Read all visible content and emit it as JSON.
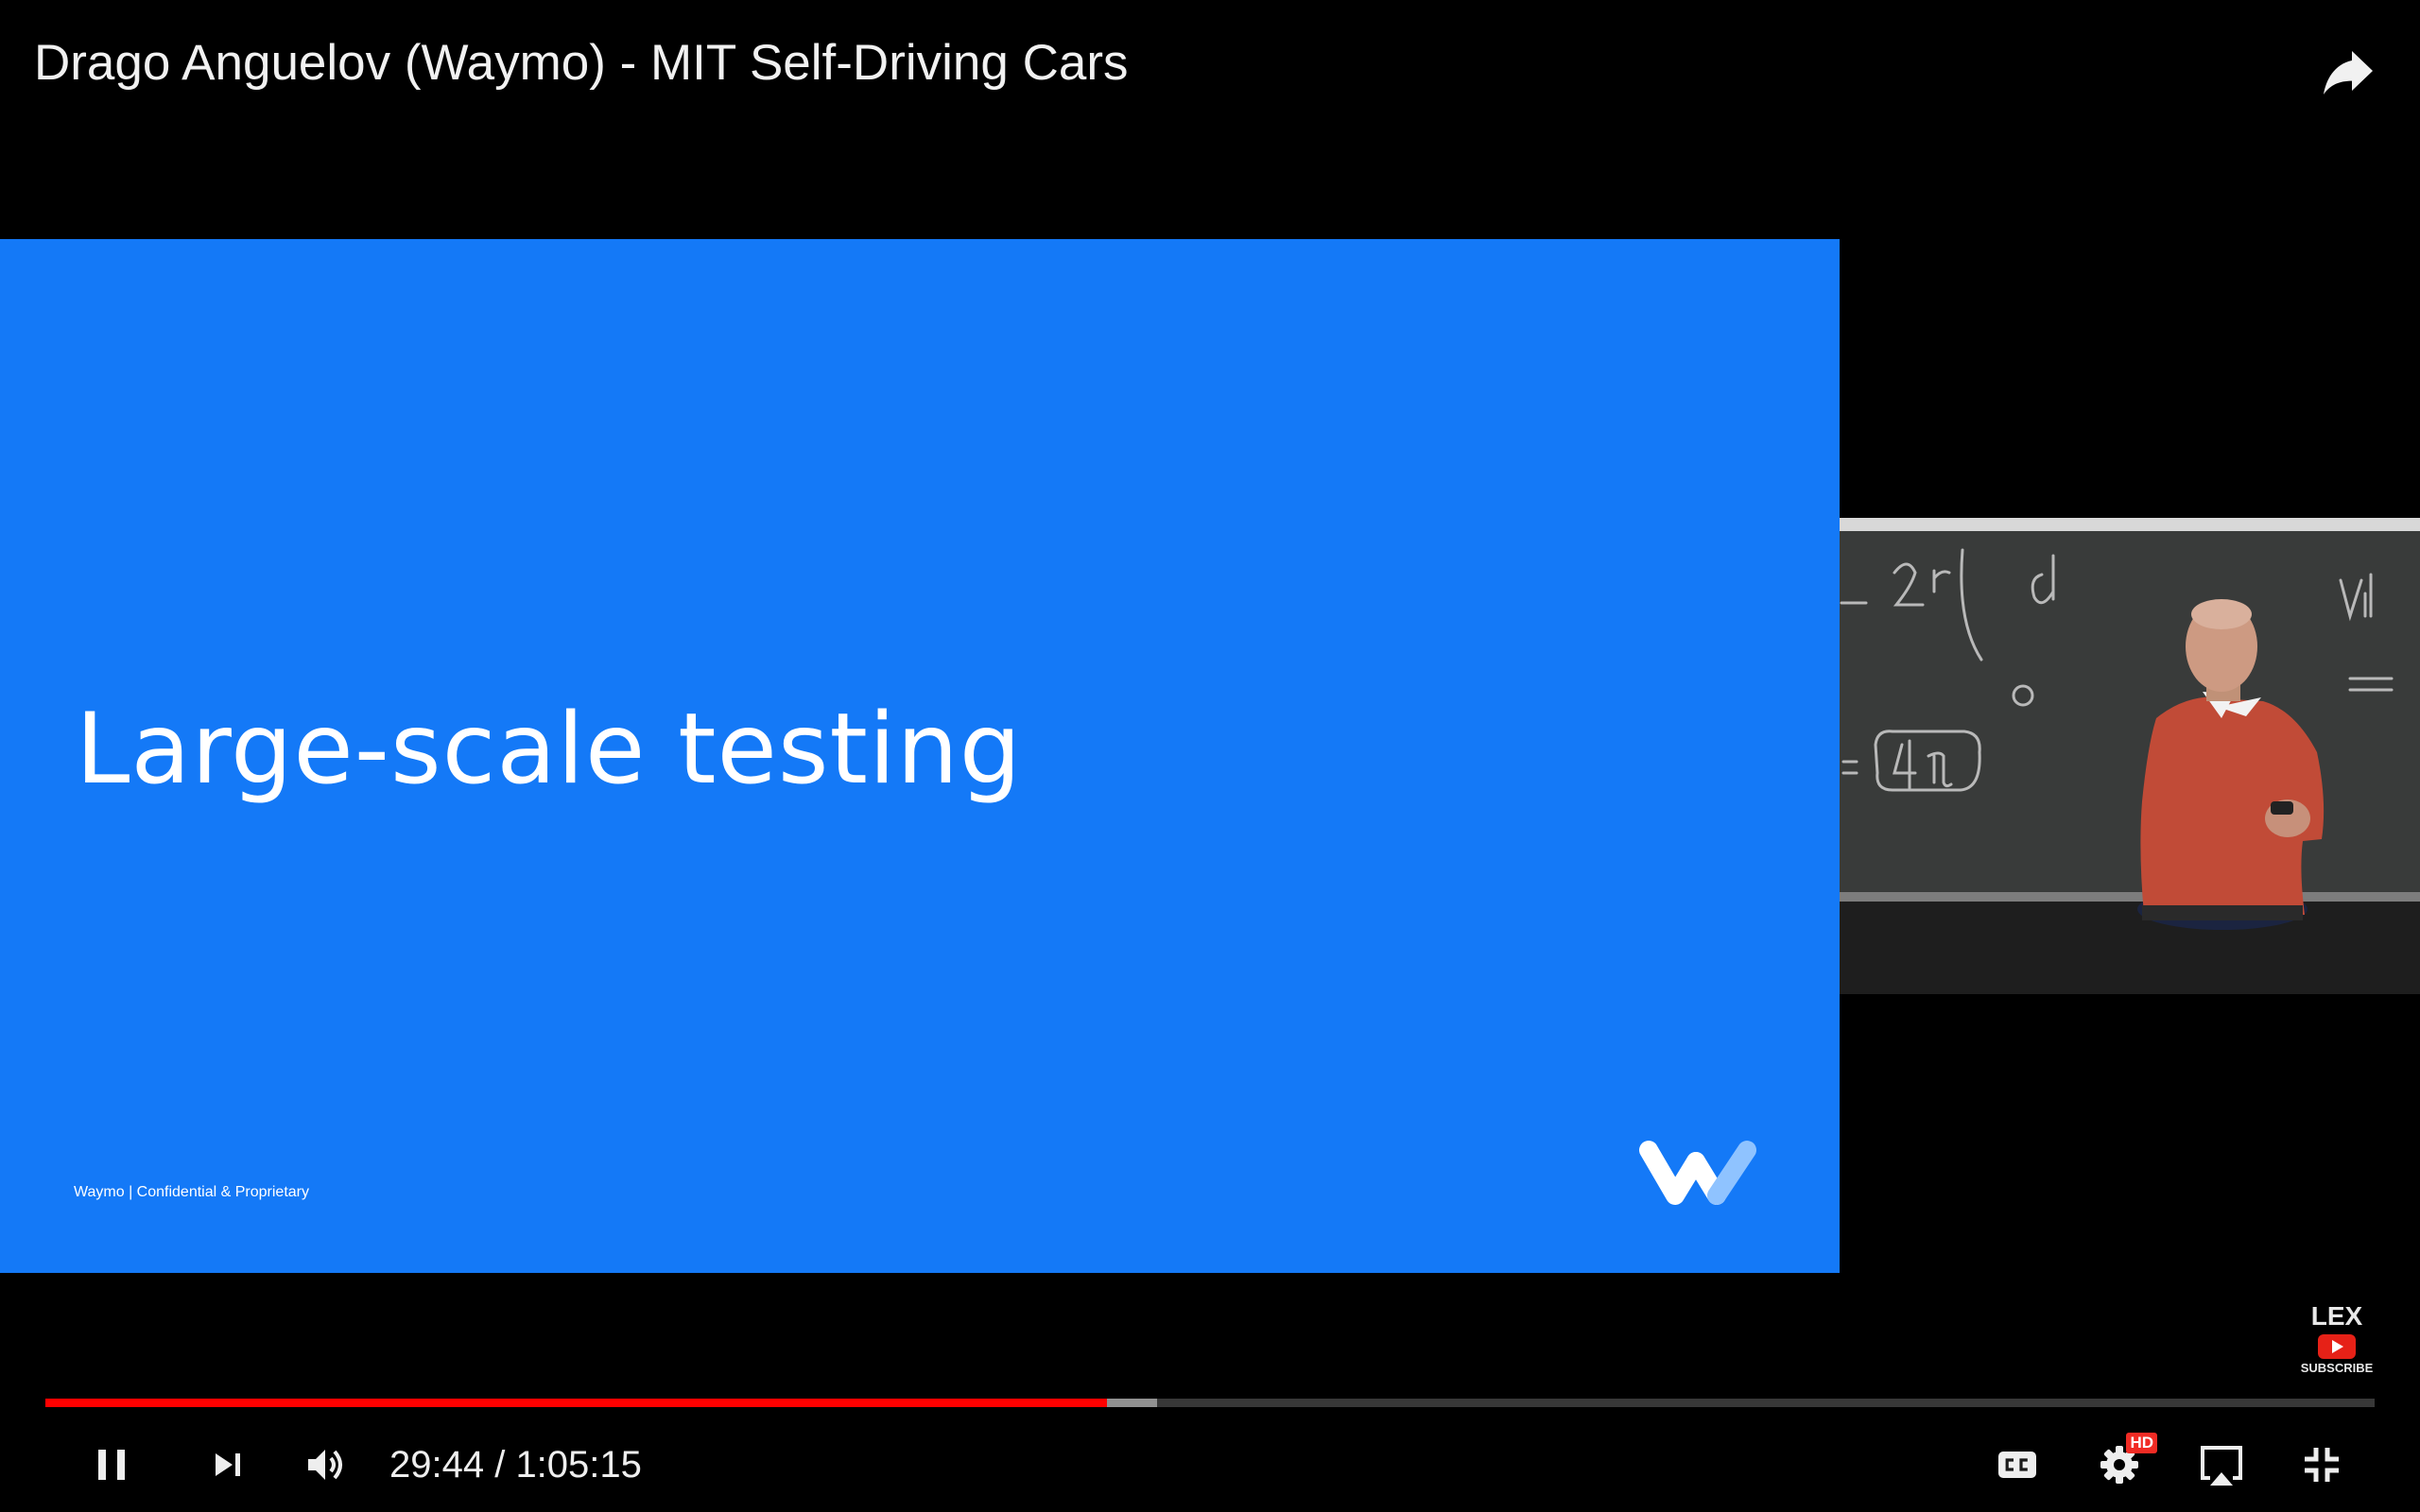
{
  "video": {
    "title": "Drago Anguelov (Waymo) - MIT Self-Driving Cars"
  },
  "slide": {
    "heading": "Large-scale testing",
    "footer": "Waymo | Confidential & Proprietary",
    "background_color": "#1479f7",
    "logo": "waymo-logo"
  },
  "watermark": {
    "channel": "LEX",
    "subscribe": "SUBSCRIBE",
    "badge_color": "#e62117"
  },
  "playback": {
    "current_time": "29:44",
    "duration": "1:05:15",
    "time_display": "29:44 / 1:05:15",
    "progress_fraction": 0.4557,
    "buffered_fraction": 0.4774,
    "progress_color": "#ff0000"
  },
  "controls": {
    "hd_badge": "HD",
    "icons": [
      "pause-icon",
      "next-icon",
      "volume-icon",
      "captions-icon",
      "settings-icon",
      "airplay-icon",
      "exit-fullscreen-icon",
      "share-icon"
    ]
  }
}
